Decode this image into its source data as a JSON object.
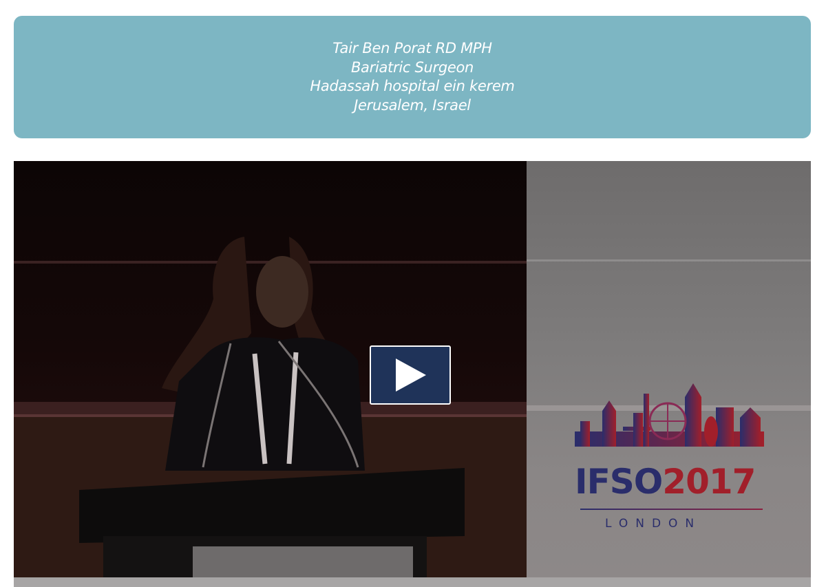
{
  "speaker": {
    "name": "Tair Ben Porat RD MPH",
    "role": "Bariatric Surgeon",
    "hospital": "Hadassah hospital ein kerem",
    "location": "Jerusalem, Israel",
    "card_color": "#7db6c3"
  },
  "video": {
    "play_icon": "play-icon",
    "play_button_color": "#1f3359",
    "logo": {
      "wordmark_part1": "IFSO",
      "wordmark_part2": "2017",
      "city": "LONDON",
      "colors": [
        "#2a2d6b",
        "#a11f2a"
      ]
    }
  }
}
